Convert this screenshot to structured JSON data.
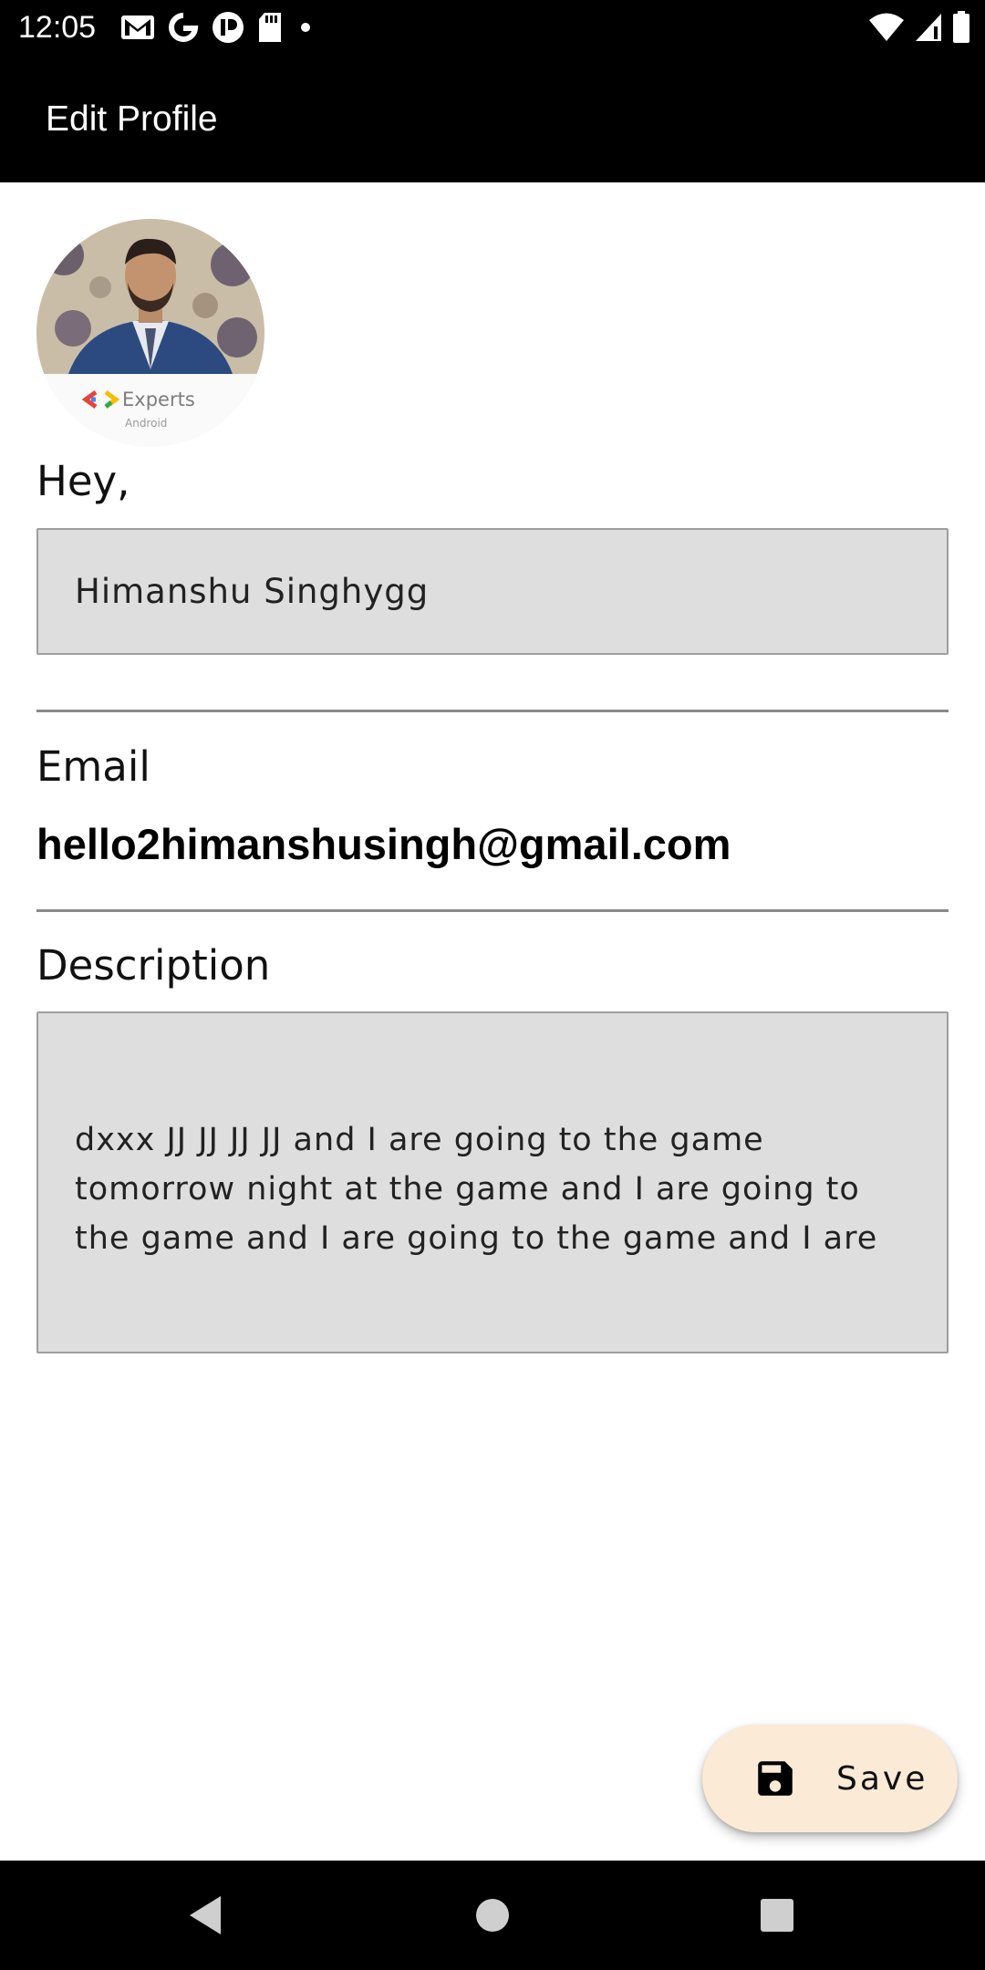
{
  "status_bar": {
    "time": "12:05",
    "left_icons": [
      "gmail-icon",
      "google-icon",
      "app-icon",
      "sd-card-icon",
      "dot-icon"
    ],
    "right_icons": [
      "wifi-icon",
      "signal-icon",
      "battery-icon"
    ]
  },
  "app_bar": {
    "title": "Edit Profile"
  },
  "profile": {
    "avatar_icon": "profile-photo",
    "avatar_caption": "Experts",
    "avatar_subcaption": "Android",
    "greeting": "Hey,",
    "name_value": "Himanshu Singhygg"
  },
  "email": {
    "label": "Email",
    "value": "hello2himanshusingh@gmail.com"
  },
  "description": {
    "label": "Description",
    "value": "dxxx JJ JJ JJ JJ and I are going to the game tomorrow night at the game and I are going to the game and I are going to the game and I are"
  },
  "fab": {
    "label": "Save",
    "icon": "save-icon",
    "background": "#fbead6"
  },
  "nav_bar": {
    "buttons": [
      "back-icon",
      "home-icon",
      "recents-icon"
    ]
  }
}
